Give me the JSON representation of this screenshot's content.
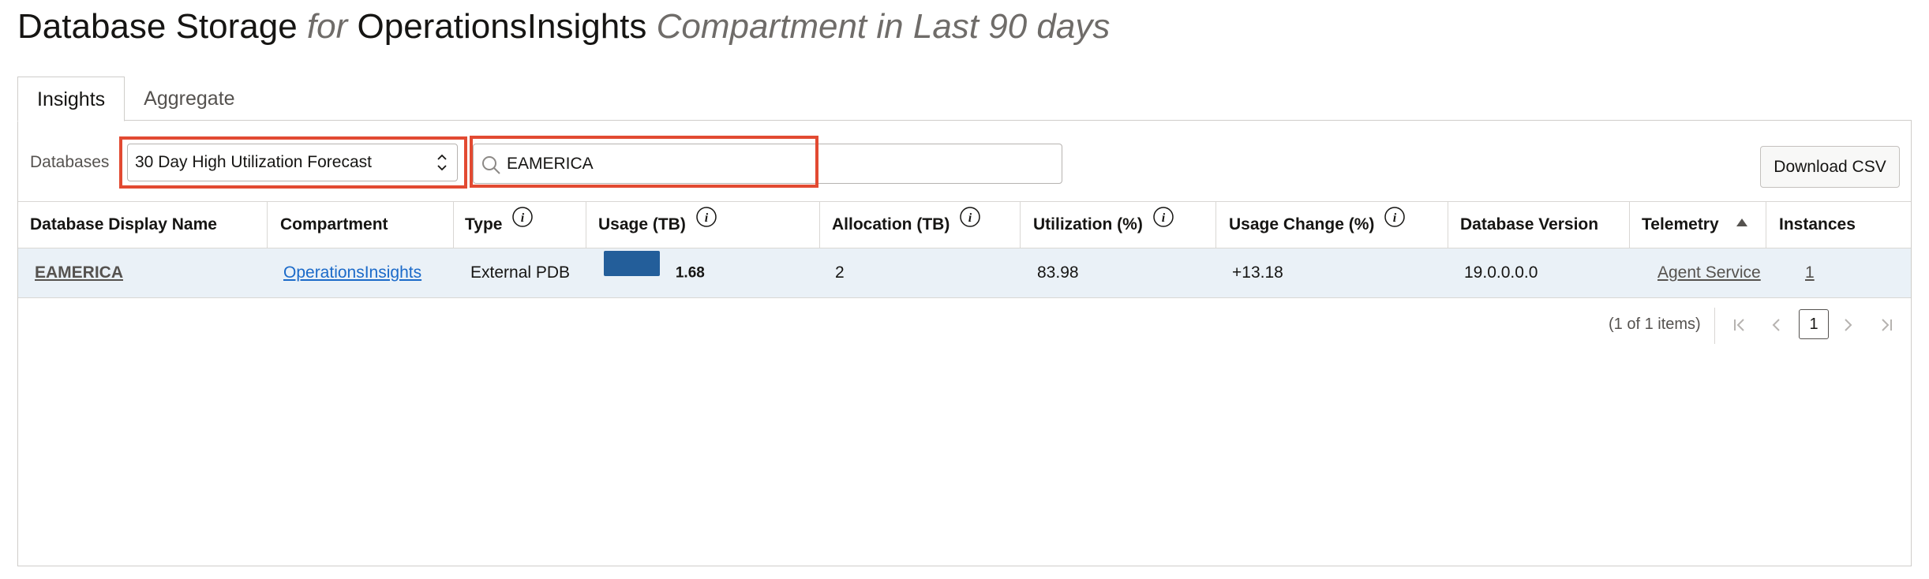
{
  "title": {
    "main": "Database Storage",
    "for": "for",
    "entity": "OperationsInsights",
    "suffix": "Compartment in Last 90 days"
  },
  "tabs": [
    {
      "label": "Insights",
      "active": true
    },
    {
      "label": "Aggregate",
      "active": false
    }
  ],
  "filter": {
    "label": "Databases",
    "select_value": "30 Day High Utilization Forecast",
    "search_value": "EAMERICA",
    "highlight_color": "#e24a32"
  },
  "actions": {
    "download_csv": "Download CSV"
  },
  "table": {
    "columns": [
      "Database Display Name",
      "Compartment",
      "Type",
      "Usage (TB)",
      "Allocation (TB)",
      "Utilization (%)",
      "Usage Change (%)",
      "Database Version",
      "Telemetry",
      "Instances"
    ],
    "rows": [
      {
        "name": "EAMERICA",
        "compartment": "OperationsInsights",
        "type": "External PDB",
        "usage": "1.68",
        "usage_fraction": 0.84,
        "allocation": "2",
        "utilization": "83.98",
        "usage_change": "+13.18",
        "version": "19.0.0.0.0",
        "telemetry": "Agent Service",
        "instances": "1"
      }
    ]
  },
  "pagination": {
    "status": "(1 of 1 items)",
    "current_page": "1"
  },
  "colors": {
    "usage_bar": "#235e9a",
    "row_highlight": "#eaf1f7",
    "link": "#1b6ac9"
  }
}
